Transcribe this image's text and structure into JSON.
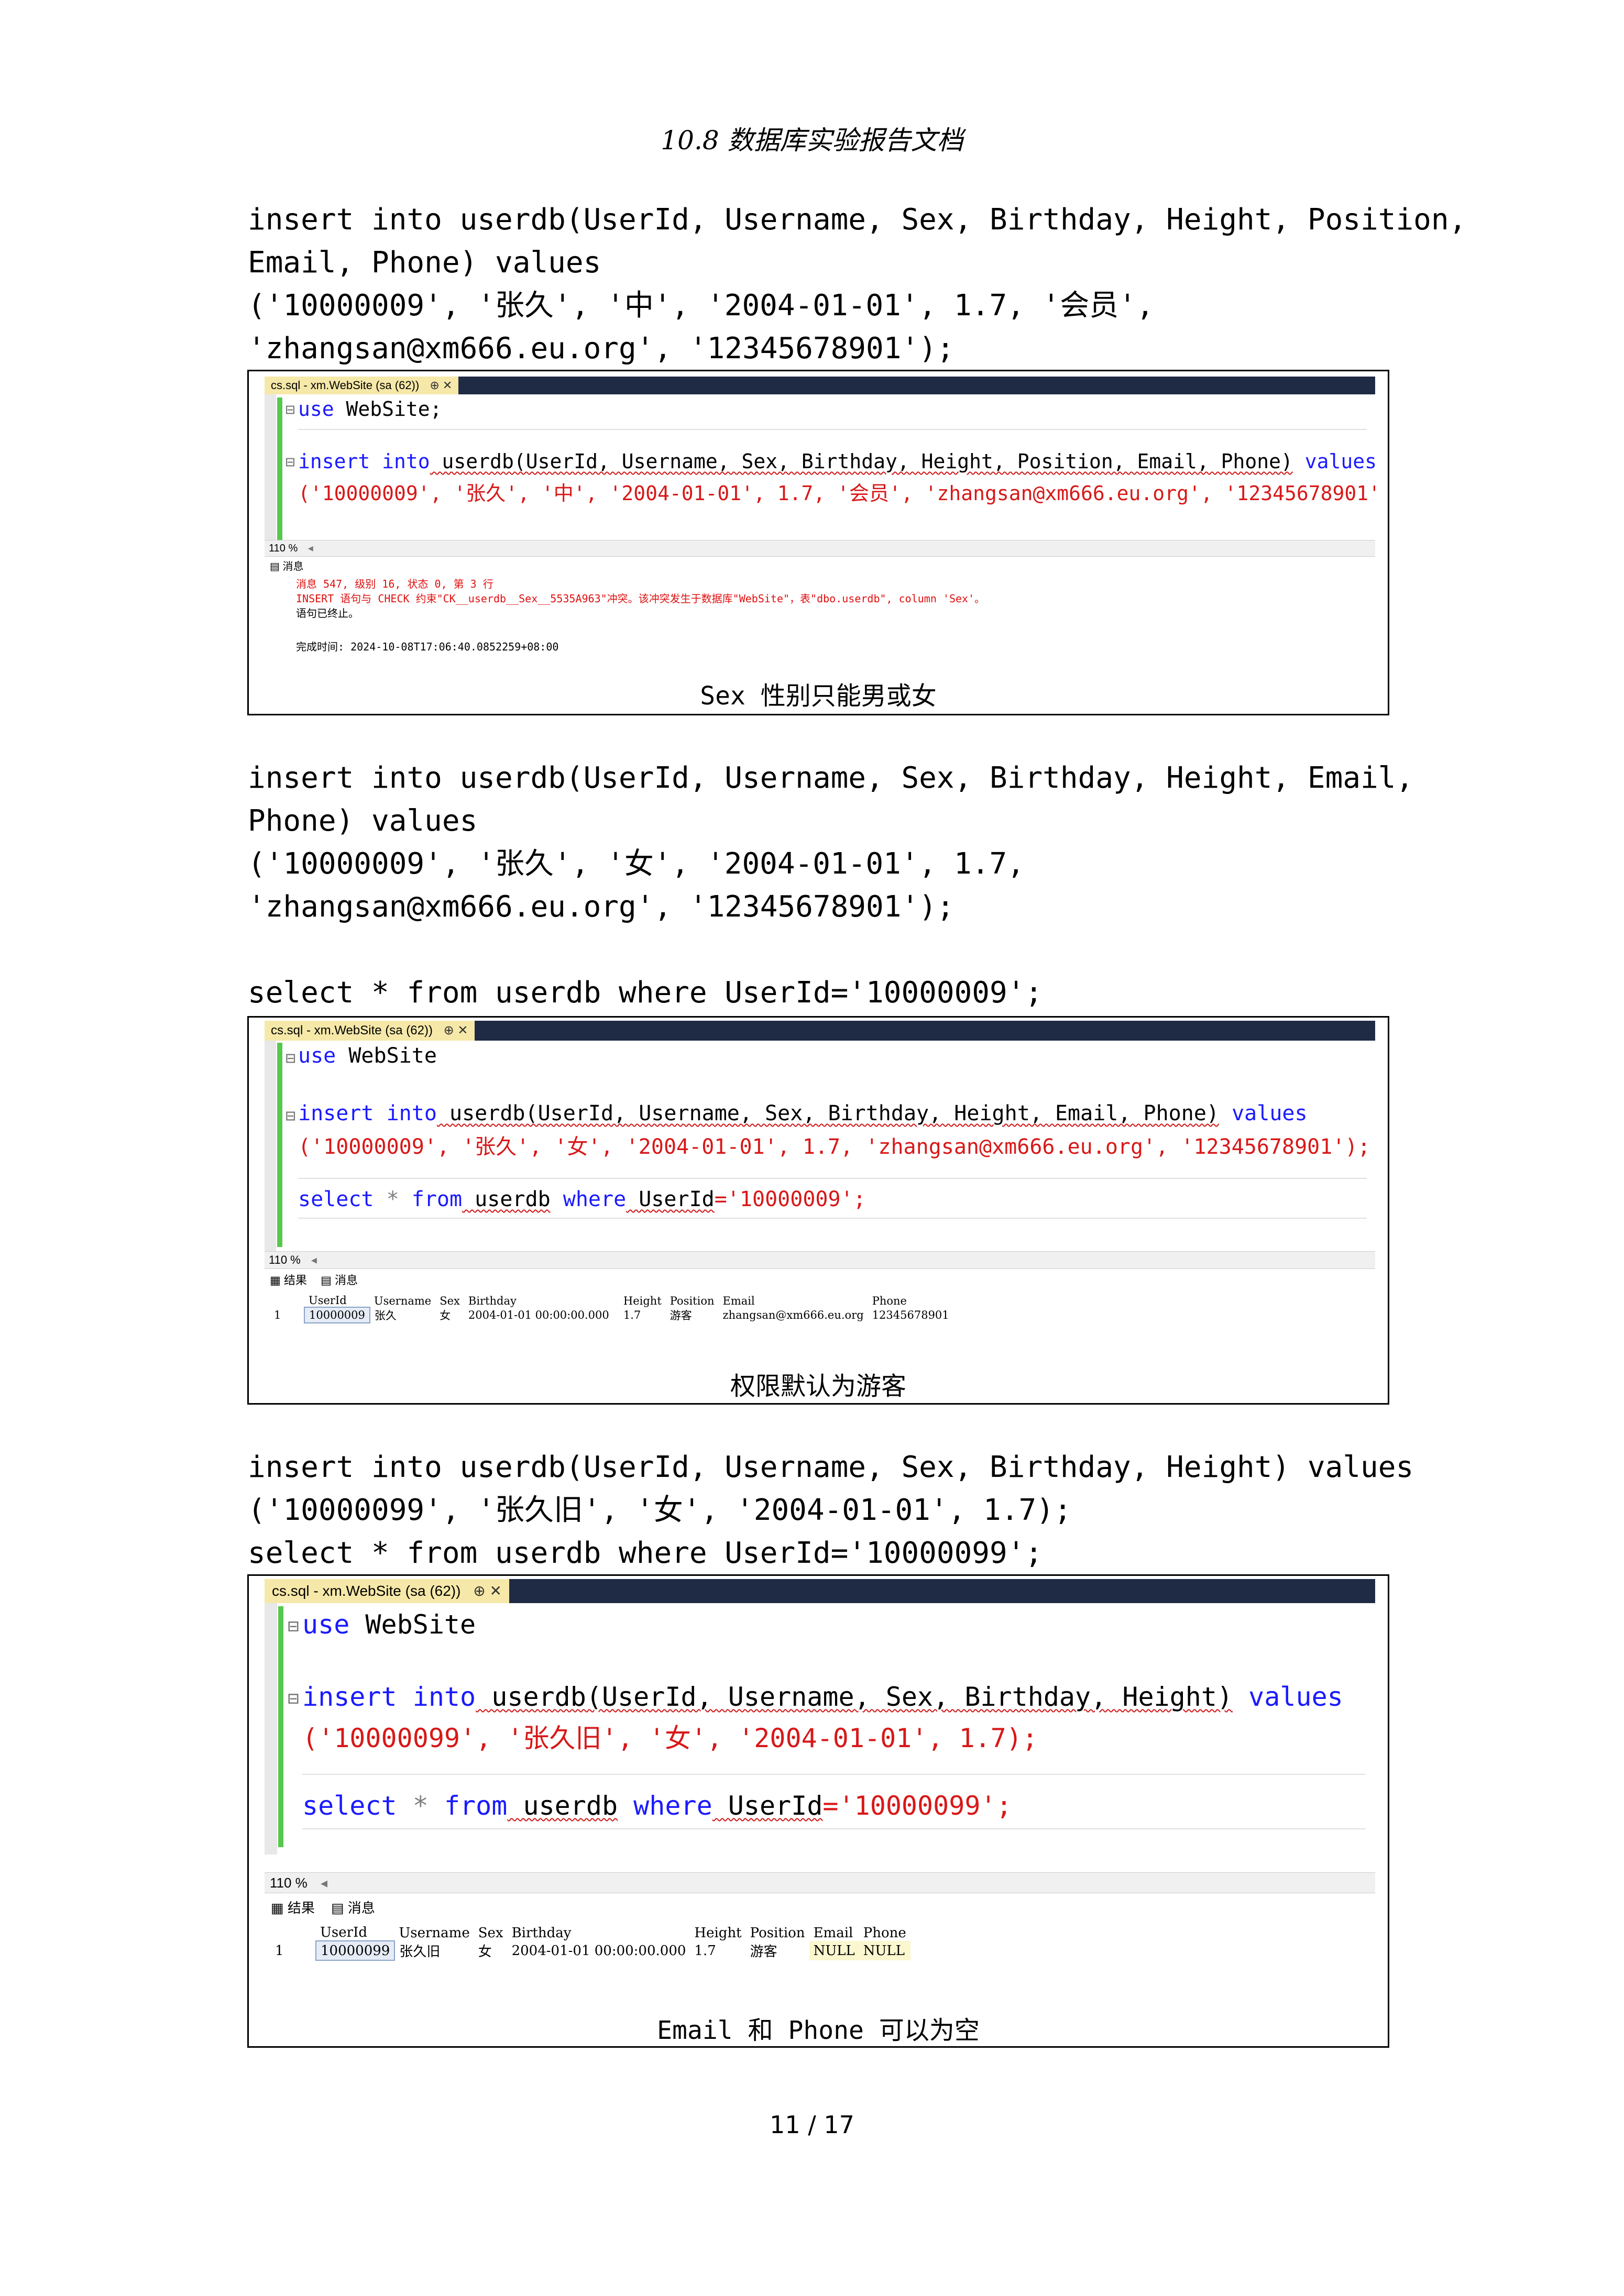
{
  "header": {
    "title": "10.8 数据库实验报告文档"
  },
  "section1": {
    "lines": [
      "insert into userdb(UserId, Username, Sex, Birthday, Height, Position,",
      "Email, Phone) values",
      "('10000009', '张久', '中', '2004-01-01', 1.7, '会员',",
      "'zhangsan@xm666.eu.org', '12345678901');"
    ],
    "screenshot": {
      "tab_title": "cs.sql - xm.WebSite (sa (62))",
      "tab_controls": "⊕ ✕",
      "code": {
        "use": "use",
        "db": " WebSite;",
        "insert": "insert",
        "into": " into",
        "table_cols": " userdb(UserId, Username, Sex, Birthday, Height, Position, Email, Phone)",
        "values": " values",
        "row": "('10000009', '张久', '中', '2004-01-01', 1.7, '会员', 'zhangsan@xm666.eu.org', '12345678901');"
      },
      "zoom": "110 %",
      "messages_tab": "消息",
      "msg_lines": [
        "消息 547, 级别 16, 状态 0, 第 3 行",
        "INSERT 语句与 CHECK 约束\"CK__userdb__Sex__5535A963\"冲突。该冲突发生于数据库\"WebSite\"，表\"dbo.userdb\", column 'Sex'。",
        "语句已终止。",
        "",
        "完成时间: 2024-10-08T17:06:40.0852259+08:00"
      ]
    },
    "caption": "Sex 性别只能男或女"
  },
  "section2": {
    "lines": [
      "insert into userdb(UserId, Username, Sex, Birthday, Height, Email,",
      "Phone) values",
      "('10000009', '张久', '女', '2004-01-01', 1.7,",
      "'zhangsan@xm666.eu.org', '12345678901');",
      "",
      "select * from userdb where UserId='10000009';"
    ],
    "screenshot": {
      "tab_title": "cs.sql - xm.WebSite (sa (62))",
      "tab_controls": "⊕ ✕",
      "code": {
        "use": "use",
        "db": " WebSite",
        "insert": "insert",
        "into": " into",
        "table_cols": " userdb(UserId, Username, Sex, Birthday, Height, Email, Phone)",
        "values": " values",
        "row": "('10000009', '张久', '女', '2004-01-01', 1.7, 'zhangsan@xm666.eu.org', '12345678901');",
        "select": "select",
        "star": " *",
        "from": " from",
        "tbl": " userdb",
        "where": " where",
        "cond_col": " UserId",
        "cond_val": "='10000009';"
      },
      "zoom": "110 %",
      "results_tab": "结果",
      "messages_tab": "消息",
      "columns": [
        "",
        "UserId",
        "Username",
        "Sex",
        "Birthday",
        "Height",
        "Position",
        "Email",
        "Phone"
      ],
      "rows": [
        [
          "1",
          "10000009",
          "张久",
          "女",
          "2004-01-01 00:00:00.000",
          "1.7",
          "游客",
          "zhangsan@xm666.eu.org",
          "12345678901"
        ]
      ]
    },
    "caption": "权限默认为游客"
  },
  "section3": {
    "lines": [
      "insert into userdb(UserId, Username, Sex, Birthday, Height) values",
      "('10000099', '张久旧', '女', '2004-01-01', 1.7);",
      "select * from userdb where UserId='10000099';"
    ],
    "screenshot": {
      "tab_title": "cs.sql - xm.WebSite (sa (62))",
      "tab_controls": "⊕ ✕",
      "code": {
        "use": "use",
        "db": " WebSite",
        "insert": "insert",
        "into": " into",
        "table_cols": " userdb(UserId, Username, Sex, Birthday, Height)",
        "values": " values",
        "row": "('10000099', '张久旧', '女', '2004-01-01', 1.7);",
        "select": "select",
        "star": " *",
        "from": " from",
        "tbl": " userdb",
        "where": " where",
        "cond_col": " UserId",
        "cond_val": "='10000099';"
      },
      "zoom": "110 %",
      "results_tab": "结果",
      "messages_tab": "消息",
      "columns": [
        "",
        "UserId",
        "Username",
        "Sex",
        "Birthday",
        "Height",
        "Position",
        "Email",
        "Phone"
      ],
      "rows": [
        [
          "1",
          "10000099",
          "张久旧",
          "女",
          "2004-01-01 00:00:00.000",
          "1.7",
          "游客",
          "NULL",
          "NULL"
        ]
      ]
    },
    "caption": "Email 和 Phone 可以为空"
  },
  "footer": {
    "page_number": "11 / 17"
  }
}
